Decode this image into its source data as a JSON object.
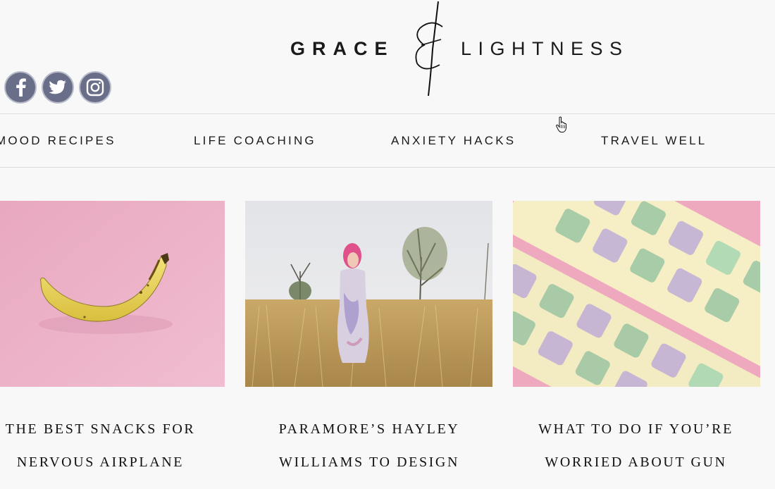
{
  "logo": {
    "left": "GRACE",
    "right": "LIGHTNESS"
  },
  "social": [
    {
      "name": "facebook-icon"
    },
    {
      "name": "twitter-icon"
    },
    {
      "name": "instagram-icon"
    }
  ],
  "nav": {
    "items": [
      {
        "label": "MOOD RECIPES"
      },
      {
        "label": "LIFE COACHING"
      },
      {
        "label": "ANXIETY HACKS"
      },
      {
        "label": "TRAVEL WELL"
      }
    ]
  },
  "posts": [
    {
      "title_line1": "THE BEST SNACKS FOR",
      "title_line2": "NERVOUS AIRPLANE"
    },
    {
      "title_line1": "PARAMORE’S HAYLEY",
      "title_line2": "WILLIAMS TO DESIGN"
    },
    {
      "title_line1": "WHAT TO DO IF YOU’RE",
      "title_line2": "WORRIED ABOUT GUN"
    }
  ],
  "colors": {
    "background": "#f8f8f8",
    "social_bg": "#6a6f89",
    "divider": "#dcdcdc"
  }
}
